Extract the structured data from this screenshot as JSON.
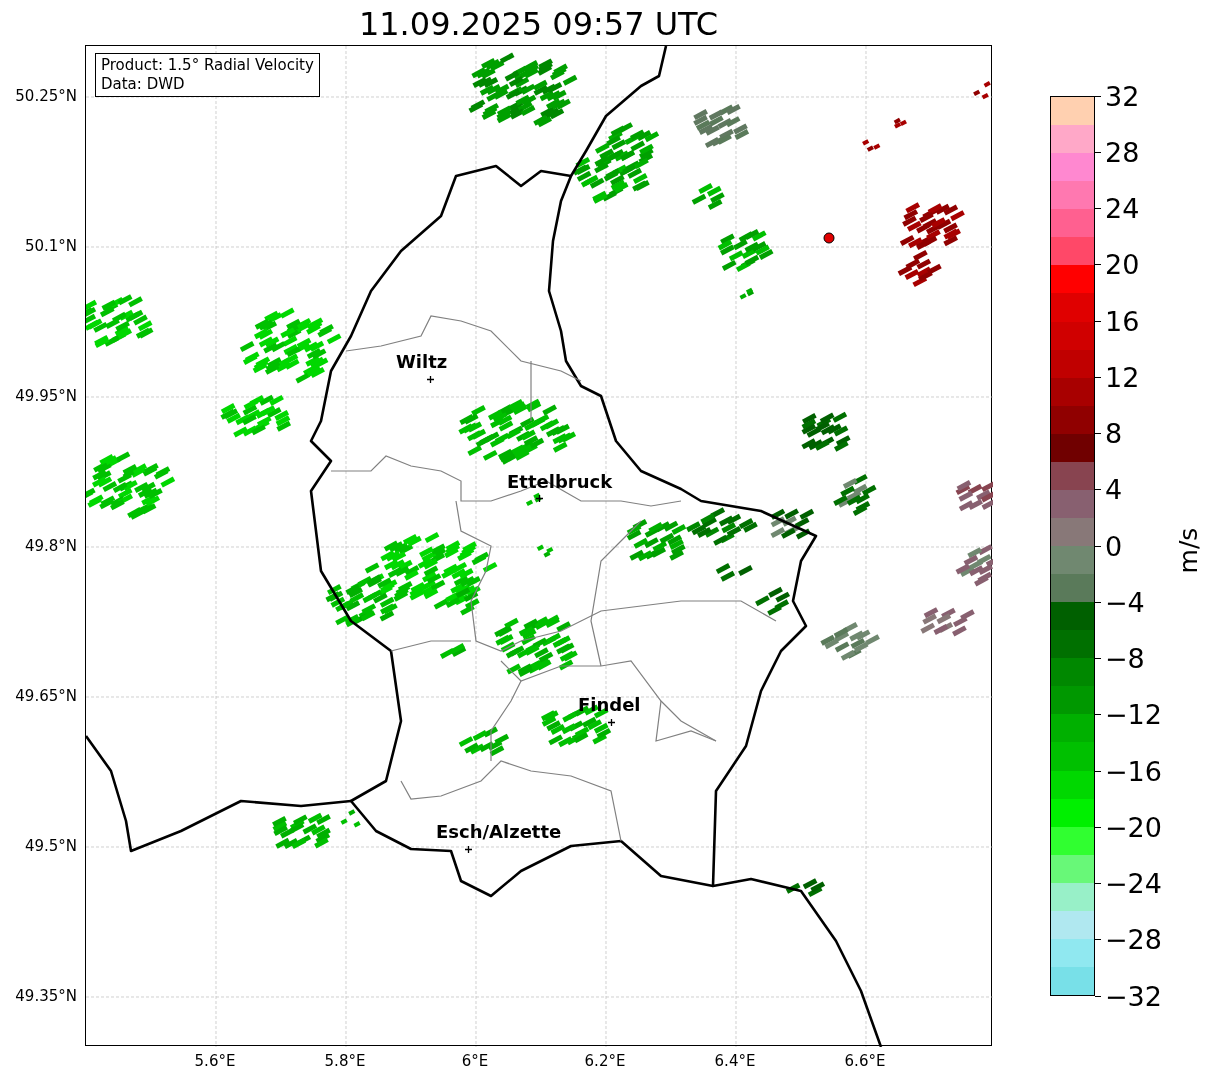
{
  "title": "11.09.2025 09:57 UTC",
  "info_box": {
    "lines": [
      "Product: 1.5° Radial Velocity",
      "Data: DWD"
    ]
  },
  "map": {
    "y_ticks": [
      "50.25°N",
      "50.1°N",
      "49.95°N",
      "49.8°N",
      "49.65°N",
      "49.5°N",
      "49.35°N"
    ],
    "x_ticks": [
      "5.6°E",
      "5.8°E",
      "6°E",
      "6.2°E",
      "6.4°E",
      "6.6°E"
    ],
    "cities": [
      {
        "name": "Wiltz"
      },
      {
        "name": "Ettelbruck"
      },
      {
        "name": "Findel"
      },
      {
        "name": "Esch/Alzette"
      }
    ]
  },
  "colorbar": {
    "label": "m/s",
    "ticks": [
      "32",
      "28",
      "24",
      "20",
      "16",
      "12",
      "8",
      "4",
      "0",
      "−4",
      "−8",
      "−12",
      "−16",
      "−20",
      "−24",
      "−28",
      "−32"
    ],
    "bins": [
      {
        "color": "#ffd0b0"
      },
      {
        "color": "#ffa8c8"
      },
      {
        "color": "#ff88d0"
      },
      {
        "color": "#ff78b0"
      },
      {
        "color": "#ff6090"
      },
      {
        "color": "#ff4868"
      },
      {
        "color": "#ff0000"
      },
      {
        "color": "#e00000"
      },
      {
        "color": "#d00000"
      },
      {
        "color": "#c00000"
      },
      {
        "color": "#a80000"
      },
      {
        "color": "#900000"
      },
      {
        "color": "#700000"
      },
      {
        "color": "#884450"
      },
      {
        "color": "#886070"
      },
      {
        "color": "#887878"
      },
      {
        "color": "#708870"
      },
      {
        "color": "#5a7a5a"
      },
      {
        "color": "#006000"
      },
      {
        "color": "#007000"
      },
      {
        "color": "#008800"
      },
      {
        "color": "#009800"
      },
      {
        "color": "#00b000"
      },
      {
        "color": "#00c000"
      },
      {
        "color": "#00d800"
      },
      {
        "color": "#00f000"
      },
      {
        "color": "#30ff30"
      },
      {
        "color": "#68f878"
      },
      {
        "color": "#98f0c8"
      },
      {
        "color": "#b0e8f0"
      },
      {
        "color": "#90e8f0"
      },
      {
        "color": "#78e0e8"
      }
    ]
  }
}
